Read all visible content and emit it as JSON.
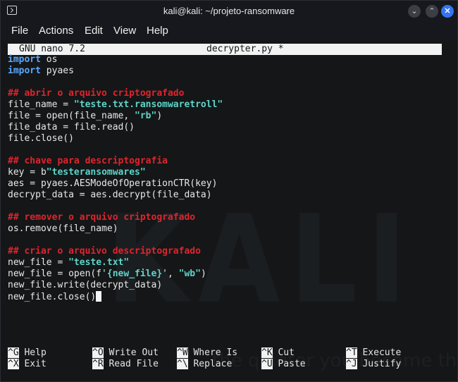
{
  "window": {
    "title": "kali@kali: ~/projeto-ransomware",
    "controls": {
      "minimize": "⌄",
      "maximize": "⌃",
      "close": "✕"
    }
  },
  "menu": [
    "File",
    "Actions",
    "Edit",
    "View",
    "Help"
  ],
  "nano": {
    "version": "GNU nano 7.2",
    "filename": "decrypter.py *"
  },
  "code_lines": [
    [
      {
        "t": "import",
        "c": "kw"
      },
      {
        "t": " os",
        "c": ""
      }
    ],
    [
      {
        "t": "import",
        "c": "kw"
      },
      {
        "t": " pyaes",
        "c": ""
      }
    ],
    [],
    [
      {
        "t": "## abrir o arquivo criptografado",
        "c": "cm"
      }
    ],
    [
      {
        "t": "file_name = ",
        "c": ""
      },
      {
        "t": "\"teste.txt.ransomwaretroll\"",
        "c": "st"
      }
    ],
    [
      {
        "t": "file = open(file_name, ",
        "c": ""
      },
      {
        "t": "\"rb\"",
        "c": "st"
      },
      {
        "t": ")",
        "c": ""
      }
    ],
    [
      {
        "t": "file_data = file.read()",
        "c": ""
      }
    ],
    [
      {
        "t": "file.close()",
        "c": ""
      }
    ],
    [],
    [
      {
        "t": "## chave para descriptografia",
        "c": "cm"
      }
    ],
    [
      {
        "t": "key = b",
        "c": ""
      },
      {
        "t": "\"testeransomwares\"",
        "c": "st"
      }
    ],
    [
      {
        "t": "aes = pyaes.AESModeOfOperationCTR(key)",
        "c": ""
      }
    ],
    [
      {
        "t": "decrypt_data = aes.decrypt(file_data)",
        "c": ""
      }
    ],
    [],
    [
      {
        "t": "## remover o arquivo criptografado",
        "c": "cm"
      }
    ],
    [
      {
        "t": "os.remove(file_name)",
        "c": ""
      }
    ],
    [],
    [
      {
        "t": "## criar o arquivo descriptografado",
        "c": "cm"
      }
    ],
    [
      {
        "t": "new_file = ",
        "c": ""
      },
      {
        "t": "\"teste.txt\"",
        "c": "st"
      }
    ],
    [
      {
        "t": "new_file = open(f'",
        "c": ""
      },
      {
        "t": "{new_file}",
        "c": "st"
      },
      {
        "t": "', ",
        "c": ""
      },
      {
        "t": "\"wb\"",
        "c": "st"
      },
      {
        "t": ")",
        "c": ""
      }
    ],
    [
      {
        "t": "new_file.write(decrypt_data)",
        "c": ""
      }
    ],
    [
      {
        "t": "new_file.close()",
        "c": ""
      },
      {
        "t": "",
        "c": "cursor"
      }
    ]
  ],
  "shortcuts": [
    {
      "key": "^G",
      "label": "Help"
    },
    {
      "key": "^X",
      "label": "Exit"
    },
    {
      "key": "^O",
      "label": "Write Out"
    },
    {
      "key": "^R",
      "label": "Read File"
    },
    {
      "key": "^W",
      "label": "Where Is"
    },
    {
      "key": "^\\",
      "label": "Replace"
    },
    {
      "key": "^K",
      "label": "Cut"
    },
    {
      "key": "^U",
      "label": "Paste"
    },
    {
      "key": "^T",
      "label": "Execute"
    },
    {
      "key": "^J",
      "label": "Justify"
    }
  ],
  "watermark": {
    "text": "KALI L",
    "tagline": "the quieter you become the more"
  },
  "colors": {
    "keyword": "#5aa8ff",
    "comment": "#e0242c",
    "string": "#5fd4c8",
    "close_button": "#3574f0"
  }
}
